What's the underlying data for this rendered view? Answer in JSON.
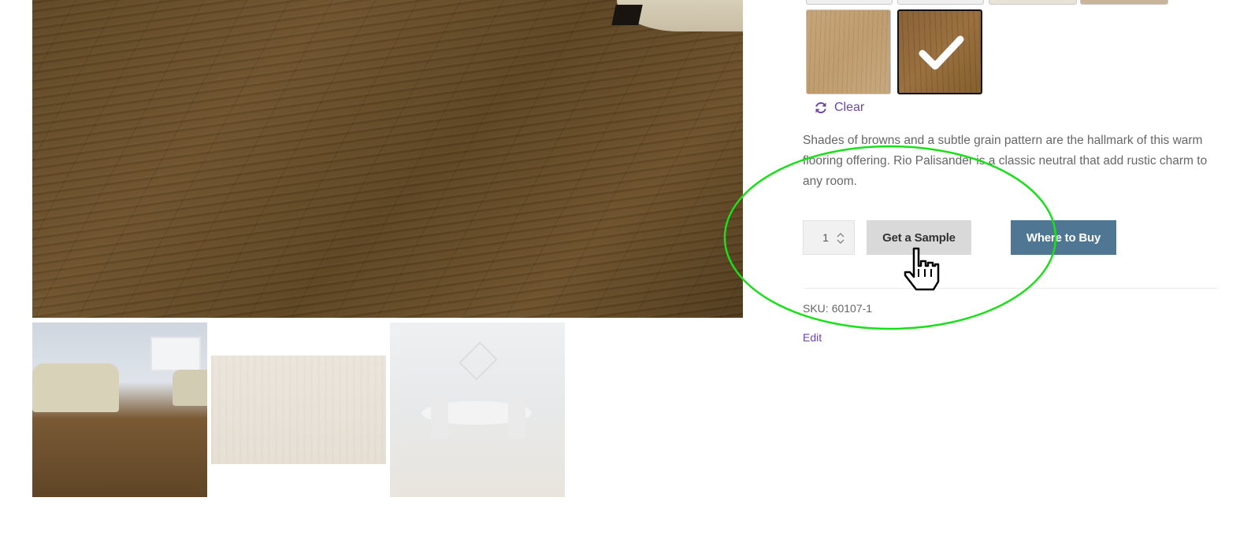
{
  "product": {
    "description": "Shades of browns and a subtle grain pattern are the hallmark of this warm flooring offering. Rio Palisander is a classic neutral that add rustic charm to any room.",
    "sku_label": "SKU:",
    "sku_value": "60107-1",
    "edit_label": "Edit"
  },
  "gallery": {
    "main_image_icon": "wood-floor-photo",
    "thumbnails": [
      {
        "icon": "living-room-photo"
      },
      {
        "icon": "plank-sample-photo"
      },
      {
        "icon": "dining-room-photo"
      }
    ]
  },
  "swatches": {
    "clear_label": "Clear",
    "clear_icon": "refresh-icon",
    "items": [
      {
        "icon": "light-oak-swatch",
        "selected": false
      },
      {
        "icon": "medium-brown-swatch",
        "selected": true,
        "selected_icon": "check-icon"
      }
    ]
  },
  "cart": {
    "quantity": "1",
    "sample_button": "Get a Sample",
    "buy_button": "Where to Buy"
  },
  "colors": {
    "accent_purple": "#6e45a8",
    "buy_button_bg": "#4f7794",
    "sample_button_bg": "#d9d9d9",
    "annotation_green": "#19e019"
  },
  "annotation": {
    "shape": "ellipse",
    "cursor_icon": "hand-pointer-icon"
  }
}
